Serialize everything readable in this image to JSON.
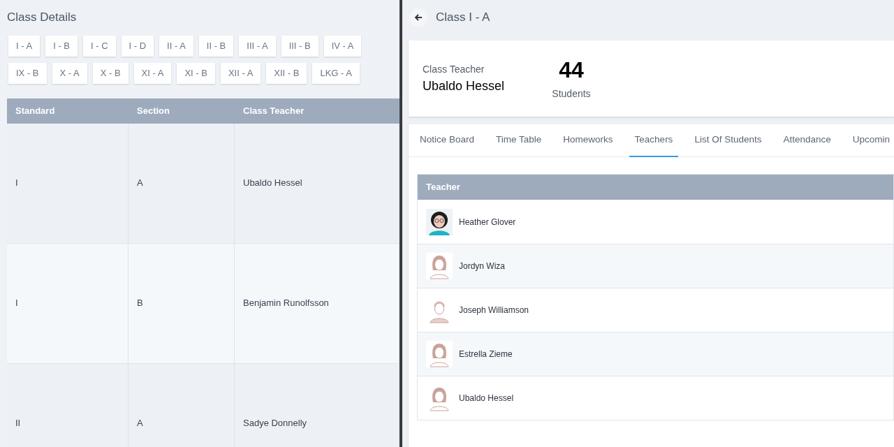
{
  "left": {
    "title": "Class Details",
    "chip_rows": [
      [
        "I - A",
        "I - B",
        "I - C",
        "I - D",
        "II - A",
        "II - B",
        "III - A",
        "III - B",
        "IV - A"
      ],
      [
        "IX - B",
        "X - A",
        "X - B",
        "XI - A",
        "XI - B",
        "XII - A",
        "XII - B",
        "LKG - A"
      ]
    ],
    "table": {
      "columns": [
        "Standard",
        "Section",
        "Class Teacher"
      ],
      "rows": [
        [
          "I",
          "A",
          "Ubaldo Hessel"
        ],
        [
          "I",
          "B",
          "Benjamin Runolfsson"
        ],
        [
          "II",
          "A",
          "Sadye Donnelly"
        ]
      ]
    }
  },
  "right": {
    "title": "Class I - A",
    "summary": {
      "teacher_label": "Class Teacher",
      "teacher_name": "Ubaldo Hessel",
      "count": "44",
      "count_label": "Students"
    },
    "tabs": [
      {
        "label": "Notice Board",
        "selected": false
      },
      {
        "label": "Time Table",
        "selected": false
      },
      {
        "label": "Homeworks",
        "selected": false
      },
      {
        "label": "Teachers",
        "selected": true
      },
      {
        "label": "List Of Students",
        "selected": false
      },
      {
        "label": "Attendance",
        "selected": false
      },
      {
        "label": "Upcomin",
        "selected": false
      }
    ],
    "teachers": {
      "column": "Teacher",
      "rows": [
        {
          "name": "Heather Glover",
          "kind": "illustration"
        },
        {
          "name": "Jordyn Wiza",
          "kind": "female"
        },
        {
          "name": "Joseph Williamson",
          "kind": "male"
        },
        {
          "name": "Estrella Zieme",
          "kind": "female"
        },
        {
          "name": "Ubaldo Hessel",
          "kind": "female"
        }
      ]
    }
  }
}
